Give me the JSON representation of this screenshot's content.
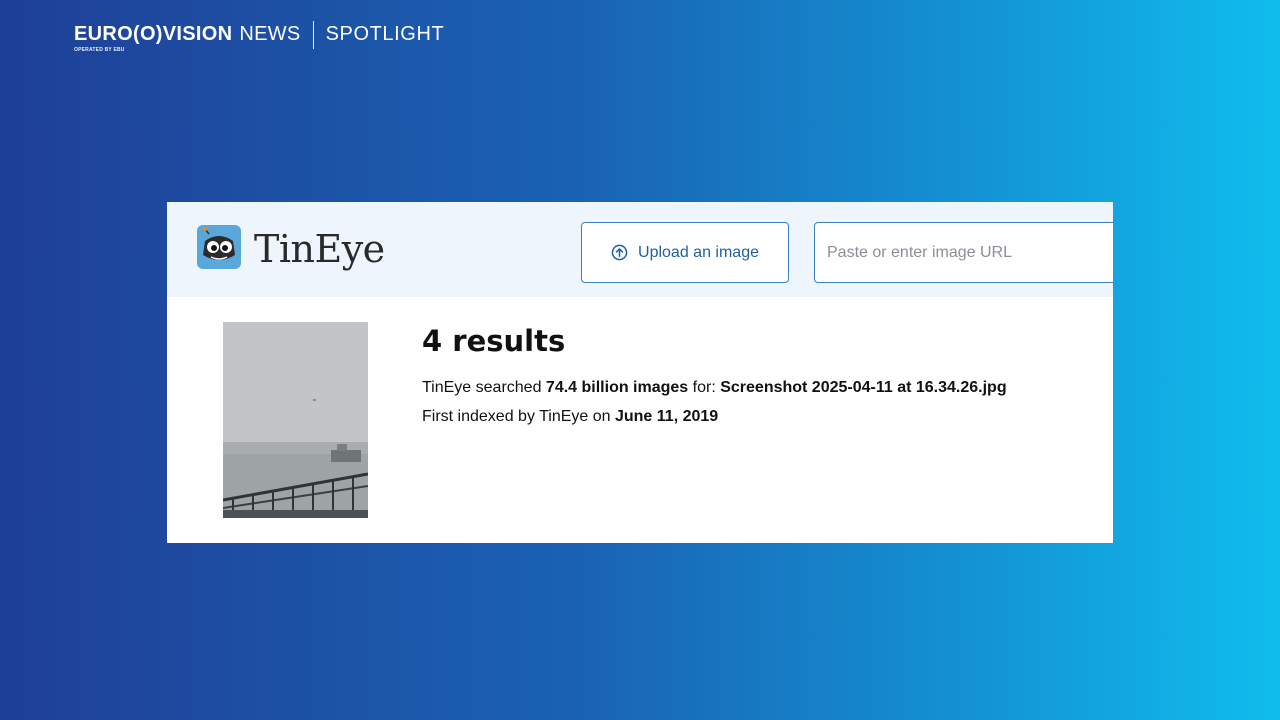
{
  "broadcaster": {
    "name": "EURO(O)VISION",
    "news": "NEWS",
    "tagline": "OPERATED BY EBU",
    "section": "SPOTLIGHT"
  },
  "tineye": {
    "logo_text": "TinEye",
    "upload_label": "Upload an image",
    "url_placeholder": "Paste or enter image URL",
    "results_title": "4 results",
    "searched_prefix": "TinEye searched ",
    "searched_count": "74.4 billion images",
    "searched_for": " for: ",
    "filename": "Screenshot 2025-04-11 at 16.34.26.jpg",
    "indexed_prefix": "First indexed by TinEye on ",
    "indexed_date": "June 11, 2019"
  },
  "colors": {
    "bg_left": "#1f3f97",
    "bg_right": "#10bded",
    "tineye_blue": "#3e7fc0",
    "header_tint": "#eef5fc"
  }
}
